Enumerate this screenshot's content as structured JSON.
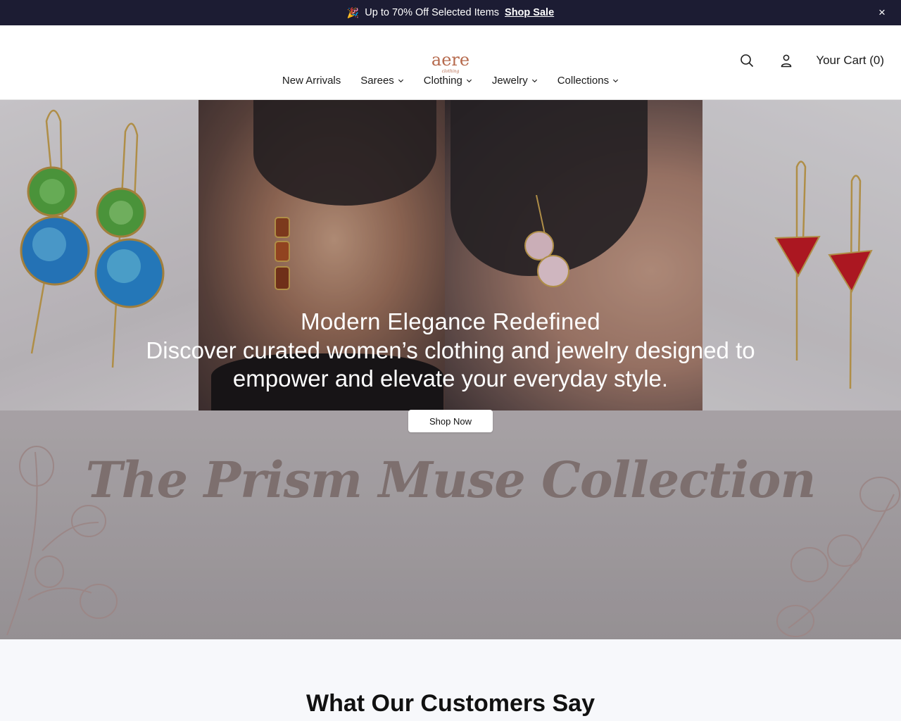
{
  "announcement": {
    "emoji": "🎉",
    "text": "Up to 70% Off Selected Items",
    "link": "Shop Sale",
    "close": "×"
  },
  "header": {
    "logo_text": "aere",
    "logo_subtext": "clothing",
    "cart_label": "Your Cart (0)"
  },
  "nav": {
    "items": [
      {
        "label": "New Arrivals"
      },
      {
        "label": "Sarees"
      },
      {
        "label": "Clothing"
      },
      {
        "label": "Jewelry"
      },
      {
        "label": "Collections"
      }
    ]
  },
  "hero": {
    "title": "Modern Elegance Redefined",
    "subtitle": "Discover curated women’s clothing and jewelry designed to empower and elevate your everyday style.",
    "cta": "Shop Now",
    "collection": "The Prism Muse Collection"
  },
  "testimonials": {
    "heading": "What Our Customers Say"
  },
  "colors": {
    "announce_bg": "#1c1c33",
    "accent": "#b66a4d",
    "collection_text": "#7d6f6e"
  }
}
